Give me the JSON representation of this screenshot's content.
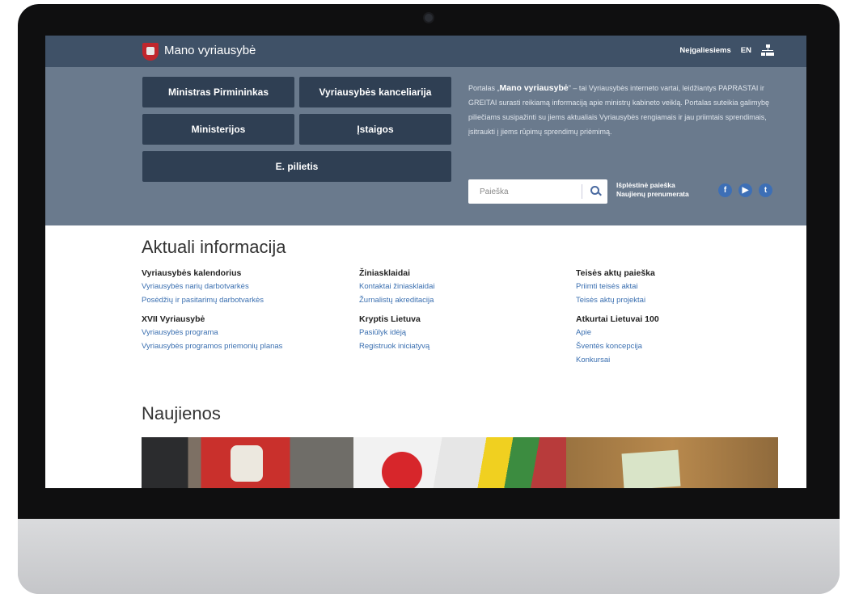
{
  "header": {
    "site_title": "Mano vyriausybė",
    "links": [
      "Neįgaliesiems",
      "EN"
    ]
  },
  "hero": {
    "buttons": [
      "Ministras Pirmininkas",
      "Vyriausybės kanceliarija",
      "Ministerijos",
      "Įstaigos",
      "E. pilietis"
    ],
    "intro_prefix": "Portalas „",
    "intro_bold": "Mano vyriausybė",
    "intro_rest": "\" – tai Vyriausybės interneto vartai, leidžiantys PAPRASTAI ir GREITAI surasti reikiamą informaciją apie ministrų kabineto veiklą. Portalas suteikia galimybę piliečiams susipažinti su jiems aktualiais Vyriausybės rengiamais ir jau priimtais sprendimais, įsitraukti į jiems rūpimų sprendimų priėmimą.",
    "search_placeholder": "Paieška",
    "advanced_search": "Išplėstinė paieška",
    "newsletter": "Naujienų prenumerata",
    "social": [
      "f",
      "▶",
      "t"
    ]
  },
  "aktuali": {
    "title": "Aktuali informacija",
    "columns": [
      {
        "groups": [
          {
            "heading": "Vyriausybės kalendorius",
            "links": [
              "Vyriausybės narių darbotvarkės",
              "Posėdžių ir pasitarimų darbotvarkės"
            ]
          },
          {
            "heading": "XVII Vyriausybė",
            "links": [
              "Vyriausybės programa",
              "Vyriausybės programos priemonių planas"
            ]
          }
        ]
      },
      {
        "groups": [
          {
            "heading": "Žiniasklaidai",
            "links": [
              "Kontaktai žiniasklaidai",
              "Žurnalistų akreditacija"
            ]
          },
          {
            "heading": "Kryptis Lietuva",
            "links": [
              "Pasiūlyk idėją",
              "Registruok iniciatyvą"
            ]
          }
        ]
      },
      {
        "groups": [
          {
            "heading": "Teisės aktų paieška",
            "links": [
              "Priimti teisės aktai",
              "Teisės aktų projektai"
            ]
          },
          {
            "heading": "Atkurtai Lietuvai 100",
            "links": [
              "Apie",
              "Šventės koncepcija",
              "Konkursai"
            ]
          }
        ]
      }
    ]
  },
  "news": {
    "title": "Naujienos"
  },
  "colors": {
    "topbar": "#3f5167",
    "hero": "#6a7a8d",
    "button": "#2f3f53",
    "link": "#3a6fb0",
    "social": "#3d6fb6"
  }
}
